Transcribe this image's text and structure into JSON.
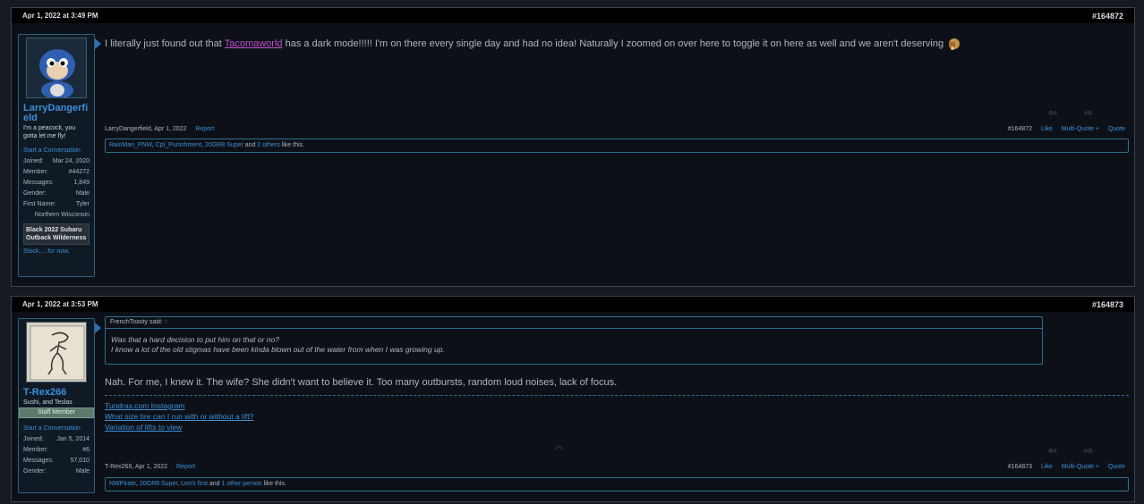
{
  "posts": [
    {
      "date": "Apr 1, 2022 at 3:49 PM",
      "number": "#164872",
      "user": {
        "name": "LarryDangerfield",
        "title": "I'm a peacock, you gotta let me fly!",
        "start_conversation": "Start a Conversation",
        "stats": [
          {
            "label": "Joined:",
            "value": "Mar 24, 2020"
          },
          {
            "label": "Member:",
            "value": "#44272"
          },
          {
            "label": "Messages:",
            "value": "1,849"
          },
          {
            "label": "Gender:",
            "value": "Male"
          },
          {
            "label": "First Name:",
            "value": "Tyler"
          }
        ],
        "location": "Northern Wisconsin",
        "vehicle": "Black 2022 Subaru Outback Wilderness",
        "vehicle_note": "Stock.....for now."
      },
      "message_before_link": "I literally just found out that ",
      "message_link": "Tacomaworld",
      "message_after_link": " has a dark mode!!!!! I'm on there every single day and had no idea! Naturally I zoomed on over here to toggle it on here as well and we aren't deserving",
      "footer_author": "LarryDangerfield, Apr 1, 2022",
      "report": "Report",
      "actions": {
        "num": "#164872",
        "like": "Like",
        "multi": "Multi-Quote +",
        "quote": "Quote"
      },
      "likes": {
        "names": [
          "RainMan_PNW",
          "Cpl_Punishment",
          "20GR8 Super"
        ],
        "and": "and",
        "others": "2 others",
        "suffix": "like this."
      }
    },
    {
      "date": "Apr 1, 2022 at 3:53 PM",
      "number": "#164873",
      "user": {
        "name": "T-Rex266",
        "title": "Sushi, and Teslas",
        "badge": "Staff Member",
        "start_conversation": "Start a Conversation",
        "stats": [
          {
            "label": "Joined:",
            "value": "Jan 5, 2014"
          },
          {
            "label": "Member:",
            "value": "#6"
          },
          {
            "label": "Messages:",
            "value": "57,010"
          },
          {
            "label": "Gender:",
            "value": "Male"
          }
        ]
      },
      "quote": {
        "author": "FrenchToasty said:",
        "arrow": "↑",
        "lines": [
          "Was that a hard decision to put him on that or no?",
          "I know a lot of the old stigmas have been kinda blown out of the water from when I was growing up."
        ]
      },
      "message": "Nah. For me, I knew it. The wife? She didn't want to believe it. Too many outbursts, random loud noises, lack of focus.",
      "signature": [
        "Tundras.com Instagram",
        "What size tire can I run with or without a lift?",
        "Variation of lifts to view"
      ],
      "footer_author": "T-Rex266, Apr 1, 2022",
      "report": "Report",
      "actions": {
        "num": "#164873",
        "like": "Like",
        "multi": "Multi-Quote +",
        "quote": "Quote"
      },
      "likes": {
        "names": [
          "NWPirate",
          "20GR8 Super",
          "Leo's first"
        ],
        "and": "and",
        "others": "1 other person",
        "suffix": "like this."
      }
    }
  ],
  "colors": {
    "link": "#3b8fd9",
    "accent_border": "#2f6f90",
    "background": "#0d1117"
  }
}
